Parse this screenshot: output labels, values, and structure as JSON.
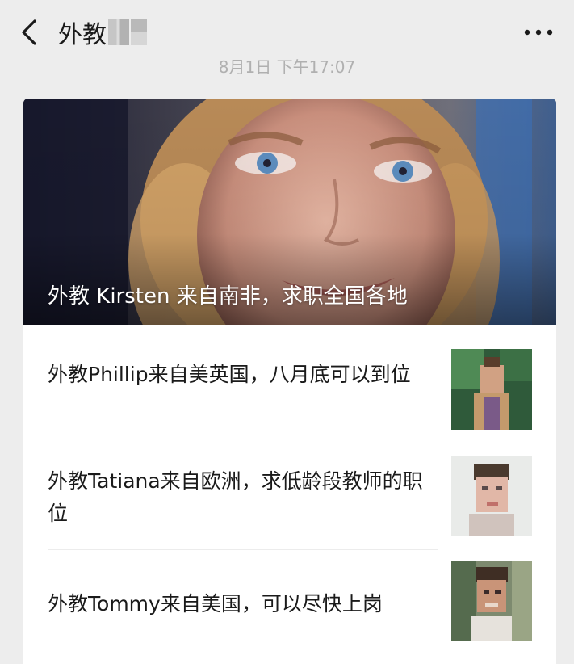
{
  "header": {
    "title": "外教",
    "back_icon": "chevron-left-icon",
    "more_icon": "more-dots-icon"
  },
  "message": {
    "timestamp": "8月1日 下午17:07"
  },
  "card": {
    "cover_title": "外教 Kirsten 来自南非，求职全国各地",
    "items": [
      {
        "title": "外教Phillip来自美英国，八月底可以到位"
      },
      {
        "title": "外教Tatiana来自欧洲，求低龄段教师的职位"
      },
      {
        "title": "外教Tommy来自美国，可以尽快上岗"
      }
    ]
  },
  "colors": {
    "background": "#ededed",
    "card": "#ffffff",
    "text": "#1a1a1a",
    "timestamp": "#b0b0b0"
  }
}
